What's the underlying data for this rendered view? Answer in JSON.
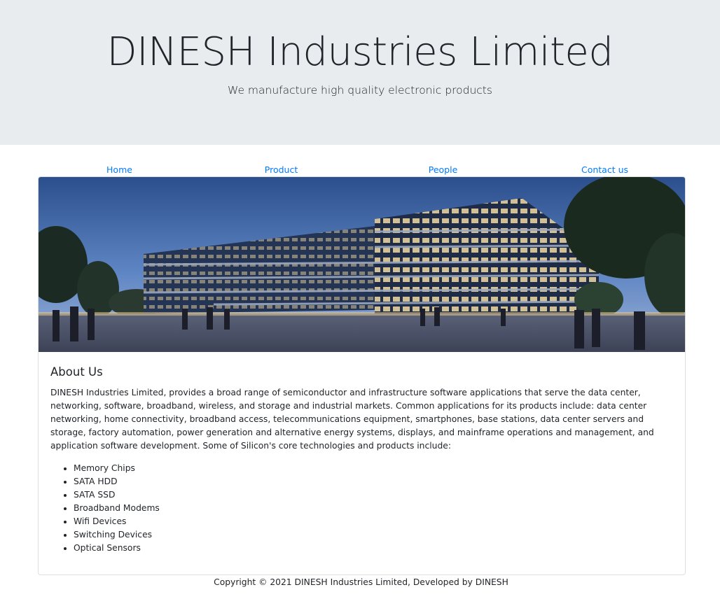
{
  "header": {
    "title": "DINESH Industries Limited",
    "subtitle": "We manufacture high quality electronic products"
  },
  "nav": {
    "items": [
      {
        "label": "Home"
      },
      {
        "label": "Product"
      },
      {
        "label": "People"
      },
      {
        "label": "Contact us"
      }
    ]
  },
  "colors": {
    "link": "#007bff",
    "jumbotron_bg": "#e9ecef",
    "text": "#212529"
  },
  "card": {
    "title": "About Us",
    "text": "DINESH Industries Limited, provides a broad range of semiconductor and infrastructure software applications that serve the data center, networking, software, broadband, wireless, and storage and industrial markets. Common applications for its products include: data center networking, home connectivity, broadband access, telecommunications equipment, smartphones, base stations, data center servers and storage, factory automation, power generation and alternative energy systems, displays, and mainframe operations and management, and application software development. Some of Silicon's core technologies and products include:",
    "list": [
      "Memory Chips",
      "SATA HDD",
      "SATA SSD",
      "Broadband Modems",
      "Wifi Devices",
      "Switching Devices",
      "Optical Sensors"
    ]
  },
  "footer": {
    "text": "Copyright © 2021 DINESH Industries Limited, Developed by DINESH"
  }
}
